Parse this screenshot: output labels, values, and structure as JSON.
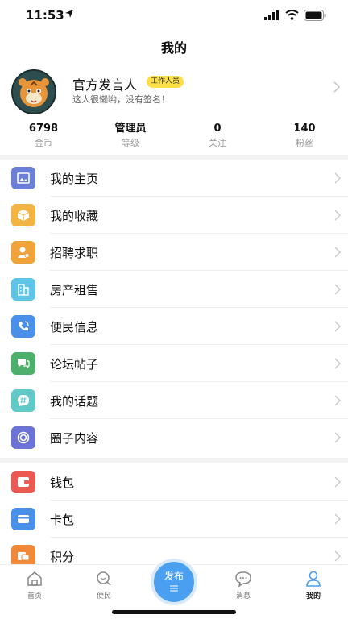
{
  "status_bar": {
    "time": "11:53"
  },
  "header": {
    "title": "我的"
  },
  "profile": {
    "name": "官方发言人",
    "badge": "工作人员",
    "signature": "这人很懒哟，没有签名！"
  },
  "stats": [
    {
      "value": "6798",
      "label": "金币"
    },
    {
      "value": "管理员",
      "label": "等级"
    },
    {
      "value": "0",
      "label": "关注"
    },
    {
      "value": "140",
      "label": "粉丝"
    }
  ],
  "menu_group1": [
    {
      "label": "我的主页",
      "icon": "homepage-icon",
      "color": "#6b7fd6"
    },
    {
      "label": "我的收藏",
      "icon": "favorites-box-icon",
      "color": "#f2b544"
    },
    {
      "label": "招聘求职",
      "icon": "recruit-icon",
      "color": "#f0a33a"
    },
    {
      "label": "房产租售",
      "icon": "building-icon",
      "color": "#5ec5e8"
    },
    {
      "label": "便民信息",
      "icon": "phone-icon",
      "color": "#4a8fe8"
    },
    {
      "label": "论坛帖子",
      "icon": "chat-icon",
      "color": "#4caf6a"
    },
    {
      "label": "我的话题",
      "icon": "topic-icon",
      "color": "#62c9c9"
    },
    {
      "label": "圈子内容",
      "icon": "circle-icon",
      "color": "#6b74d6"
    }
  ],
  "menu_group2": [
    {
      "label": "钱包",
      "icon": "wallet-icon",
      "color": "#ea5a52"
    },
    {
      "label": "卡包",
      "icon": "card-icon",
      "color": "#4a8fe8"
    },
    {
      "label": "积分",
      "icon": "points-icon",
      "color": "#f08a3a"
    }
  ],
  "tabbar": {
    "home": "首页",
    "convenience": "便民",
    "publish": "发布",
    "messages": "消息",
    "mine": "我的",
    "accent": "#4a9ff0"
  }
}
